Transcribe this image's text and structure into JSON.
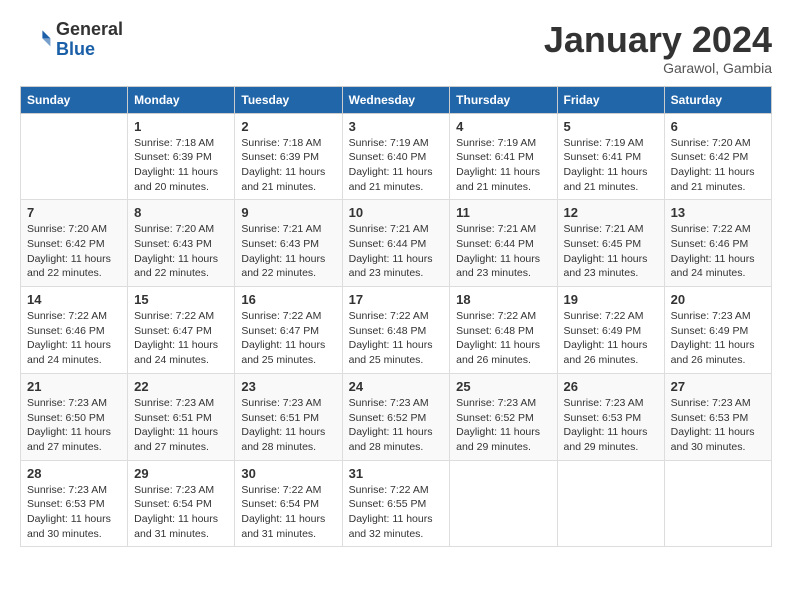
{
  "logo": {
    "general": "General",
    "blue": "Blue"
  },
  "header": {
    "title": "January 2024",
    "subtitle": "Garawol, Gambia"
  },
  "columns": [
    "Sunday",
    "Monday",
    "Tuesday",
    "Wednesday",
    "Thursday",
    "Friday",
    "Saturday"
  ],
  "weeks": [
    [
      {
        "num": "",
        "info": ""
      },
      {
        "num": "1",
        "info": "Sunrise: 7:18 AM\nSunset: 6:39 PM\nDaylight: 11 hours\nand 20 minutes."
      },
      {
        "num": "2",
        "info": "Sunrise: 7:18 AM\nSunset: 6:39 PM\nDaylight: 11 hours\nand 21 minutes."
      },
      {
        "num": "3",
        "info": "Sunrise: 7:19 AM\nSunset: 6:40 PM\nDaylight: 11 hours\nand 21 minutes."
      },
      {
        "num": "4",
        "info": "Sunrise: 7:19 AM\nSunset: 6:41 PM\nDaylight: 11 hours\nand 21 minutes."
      },
      {
        "num": "5",
        "info": "Sunrise: 7:19 AM\nSunset: 6:41 PM\nDaylight: 11 hours\nand 21 minutes."
      },
      {
        "num": "6",
        "info": "Sunrise: 7:20 AM\nSunset: 6:42 PM\nDaylight: 11 hours\nand 21 minutes."
      }
    ],
    [
      {
        "num": "7",
        "info": "Sunrise: 7:20 AM\nSunset: 6:42 PM\nDaylight: 11 hours\nand 22 minutes."
      },
      {
        "num": "8",
        "info": "Sunrise: 7:20 AM\nSunset: 6:43 PM\nDaylight: 11 hours\nand 22 minutes."
      },
      {
        "num": "9",
        "info": "Sunrise: 7:21 AM\nSunset: 6:43 PM\nDaylight: 11 hours\nand 22 minutes."
      },
      {
        "num": "10",
        "info": "Sunrise: 7:21 AM\nSunset: 6:44 PM\nDaylight: 11 hours\nand 23 minutes."
      },
      {
        "num": "11",
        "info": "Sunrise: 7:21 AM\nSunset: 6:44 PM\nDaylight: 11 hours\nand 23 minutes."
      },
      {
        "num": "12",
        "info": "Sunrise: 7:21 AM\nSunset: 6:45 PM\nDaylight: 11 hours\nand 23 minutes."
      },
      {
        "num": "13",
        "info": "Sunrise: 7:22 AM\nSunset: 6:46 PM\nDaylight: 11 hours\nand 24 minutes."
      }
    ],
    [
      {
        "num": "14",
        "info": "Sunrise: 7:22 AM\nSunset: 6:46 PM\nDaylight: 11 hours\nand 24 minutes."
      },
      {
        "num": "15",
        "info": "Sunrise: 7:22 AM\nSunset: 6:47 PM\nDaylight: 11 hours\nand 24 minutes."
      },
      {
        "num": "16",
        "info": "Sunrise: 7:22 AM\nSunset: 6:47 PM\nDaylight: 11 hours\nand 25 minutes."
      },
      {
        "num": "17",
        "info": "Sunrise: 7:22 AM\nSunset: 6:48 PM\nDaylight: 11 hours\nand 25 minutes."
      },
      {
        "num": "18",
        "info": "Sunrise: 7:22 AM\nSunset: 6:48 PM\nDaylight: 11 hours\nand 26 minutes."
      },
      {
        "num": "19",
        "info": "Sunrise: 7:22 AM\nSunset: 6:49 PM\nDaylight: 11 hours\nand 26 minutes."
      },
      {
        "num": "20",
        "info": "Sunrise: 7:23 AM\nSunset: 6:49 PM\nDaylight: 11 hours\nand 26 minutes."
      }
    ],
    [
      {
        "num": "21",
        "info": "Sunrise: 7:23 AM\nSunset: 6:50 PM\nDaylight: 11 hours\nand 27 minutes."
      },
      {
        "num": "22",
        "info": "Sunrise: 7:23 AM\nSunset: 6:51 PM\nDaylight: 11 hours\nand 27 minutes."
      },
      {
        "num": "23",
        "info": "Sunrise: 7:23 AM\nSunset: 6:51 PM\nDaylight: 11 hours\nand 28 minutes."
      },
      {
        "num": "24",
        "info": "Sunrise: 7:23 AM\nSunset: 6:52 PM\nDaylight: 11 hours\nand 28 minutes."
      },
      {
        "num": "25",
        "info": "Sunrise: 7:23 AM\nSunset: 6:52 PM\nDaylight: 11 hours\nand 29 minutes."
      },
      {
        "num": "26",
        "info": "Sunrise: 7:23 AM\nSunset: 6:53 PM\nDaylight: 11 hours\nand 29 minutes."
      },
      {
        "num": "27",
        "info": "Sunrise: 7:23 AM\nSunset: 6:53 PM\nDaylight: 11 hours\nand 30 minutes."
      }
    ],
    [
      {
        "num": "28",
        "info": "Sunrise: 7:23 AM\nSunset: 6:53 PM\nDaylight: 11 hours\nand 30 minutes."
      },
      {
        "num": "29",
        "info": "Sunrise: 7:23 AM\nSunset: 6:54 PM\nDaylight: 11 hours\nand 31 minutes."
      },
      {
        "num": "30",
        "info": "Sunrise: 7:22 AM\nSunset: 6:54 PM\nDaylight: 11 hours\nand 31 minutes."
      },
      {
        "num": "31",
        "info": "Sunrise: 7:22 AM\nSunset: 6:55 PM\nDaylight: 11 hours\nand 32 minutes."
      },
      {
        "num": "",
        "info": ""
      },
      {
        "num": "",
        "info": ""
      },
      {
        "num": "",
        "info": ""
      }
    ]
  ]
}
